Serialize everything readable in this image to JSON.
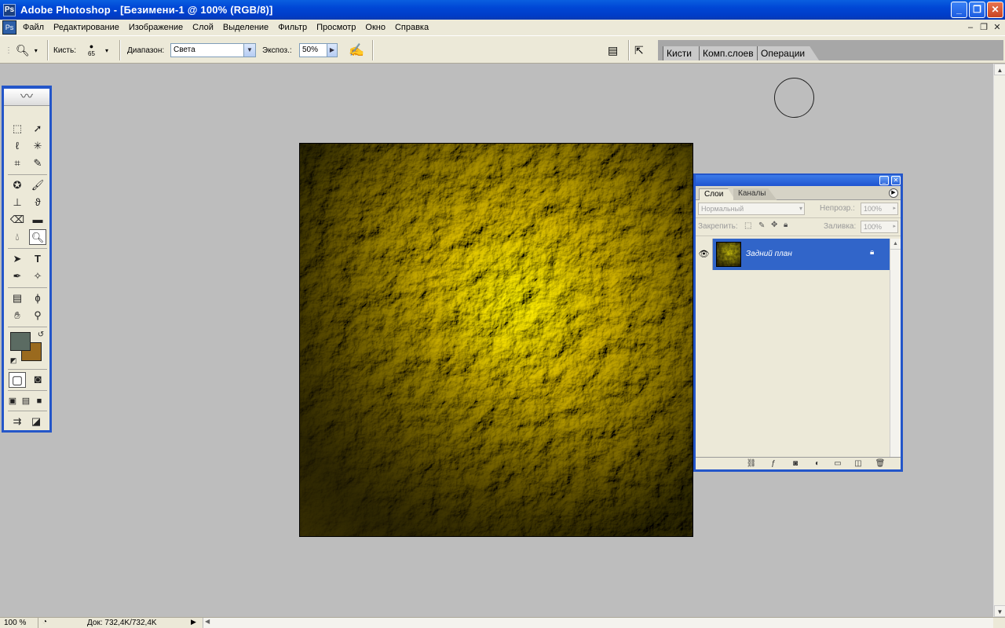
{
  "window": {
    "title": "Adobe Photoshop - [Безимени-1 @ 100% (RGB/8)]"
  },
  "menu": {
    "items": [
      "Файл",
      "Редактирование",
      "Изображение",
      "Слой",
      "Выделение",
      "Фильтр",
      "Просмотр",
      "Окно",
      "Справка"
    ]
  },
  "options": {
    "brush_label": "Кисть:",
    "brush_size": "65",
    "range_label": "Диапазон:",
    "range_value": "Света",
    "exposure_label": "Экспоз.:",
    "exposure_value": "50%"
  },
  "palette_well": {
    "tabs": [
      "Кисти",
      "Комп.слоев",
      "Операции"
    ]
  },
  "layers_panel": {
    "tabs": [
      "Слои",
      "Каналы"
    ],
    "blend_mode": "Нормальный",
    "opacity_label": "Непрозр.:",
    "opacity_value": "100%",
    "lock_label": "Закрепить:",
    "fill_label": "Заливка:",
    "fill_value": "100%",
    "layer_name": "Задний план"
  },
  "status": {
    "zoom": "100 %",
    "doc_info": "Док: 732,4K/732,4K"
  },
  "colors": {
    "foreground": "#5b6b62",
    "background": "#9a6a1e",
    "title_bar": "#0046d5",
    "selection": "#3165c9"
  },
  "icons": {
    "toolbox": [
      "marquee-icon",
      "move-icon",
      "lasso-icon",
      "magic-wand-icon",
      "crop-icon",
      "slice-icon",
      "healing-icon",
      "brush-icon",
      "stamp-icon",
      "history-brush-icon",
      "eraser-icon",
      "gradient-icon",
      "blur-icon",
      "dodge-icon",
      "path-select-icon",
      "type-icon",
      "pen-icon",
      "shape-icon",
      "notes-icon",
      "eyedropper-icon",
      "hand-icon",
      "zoom-icon"
    ]
  }
}
